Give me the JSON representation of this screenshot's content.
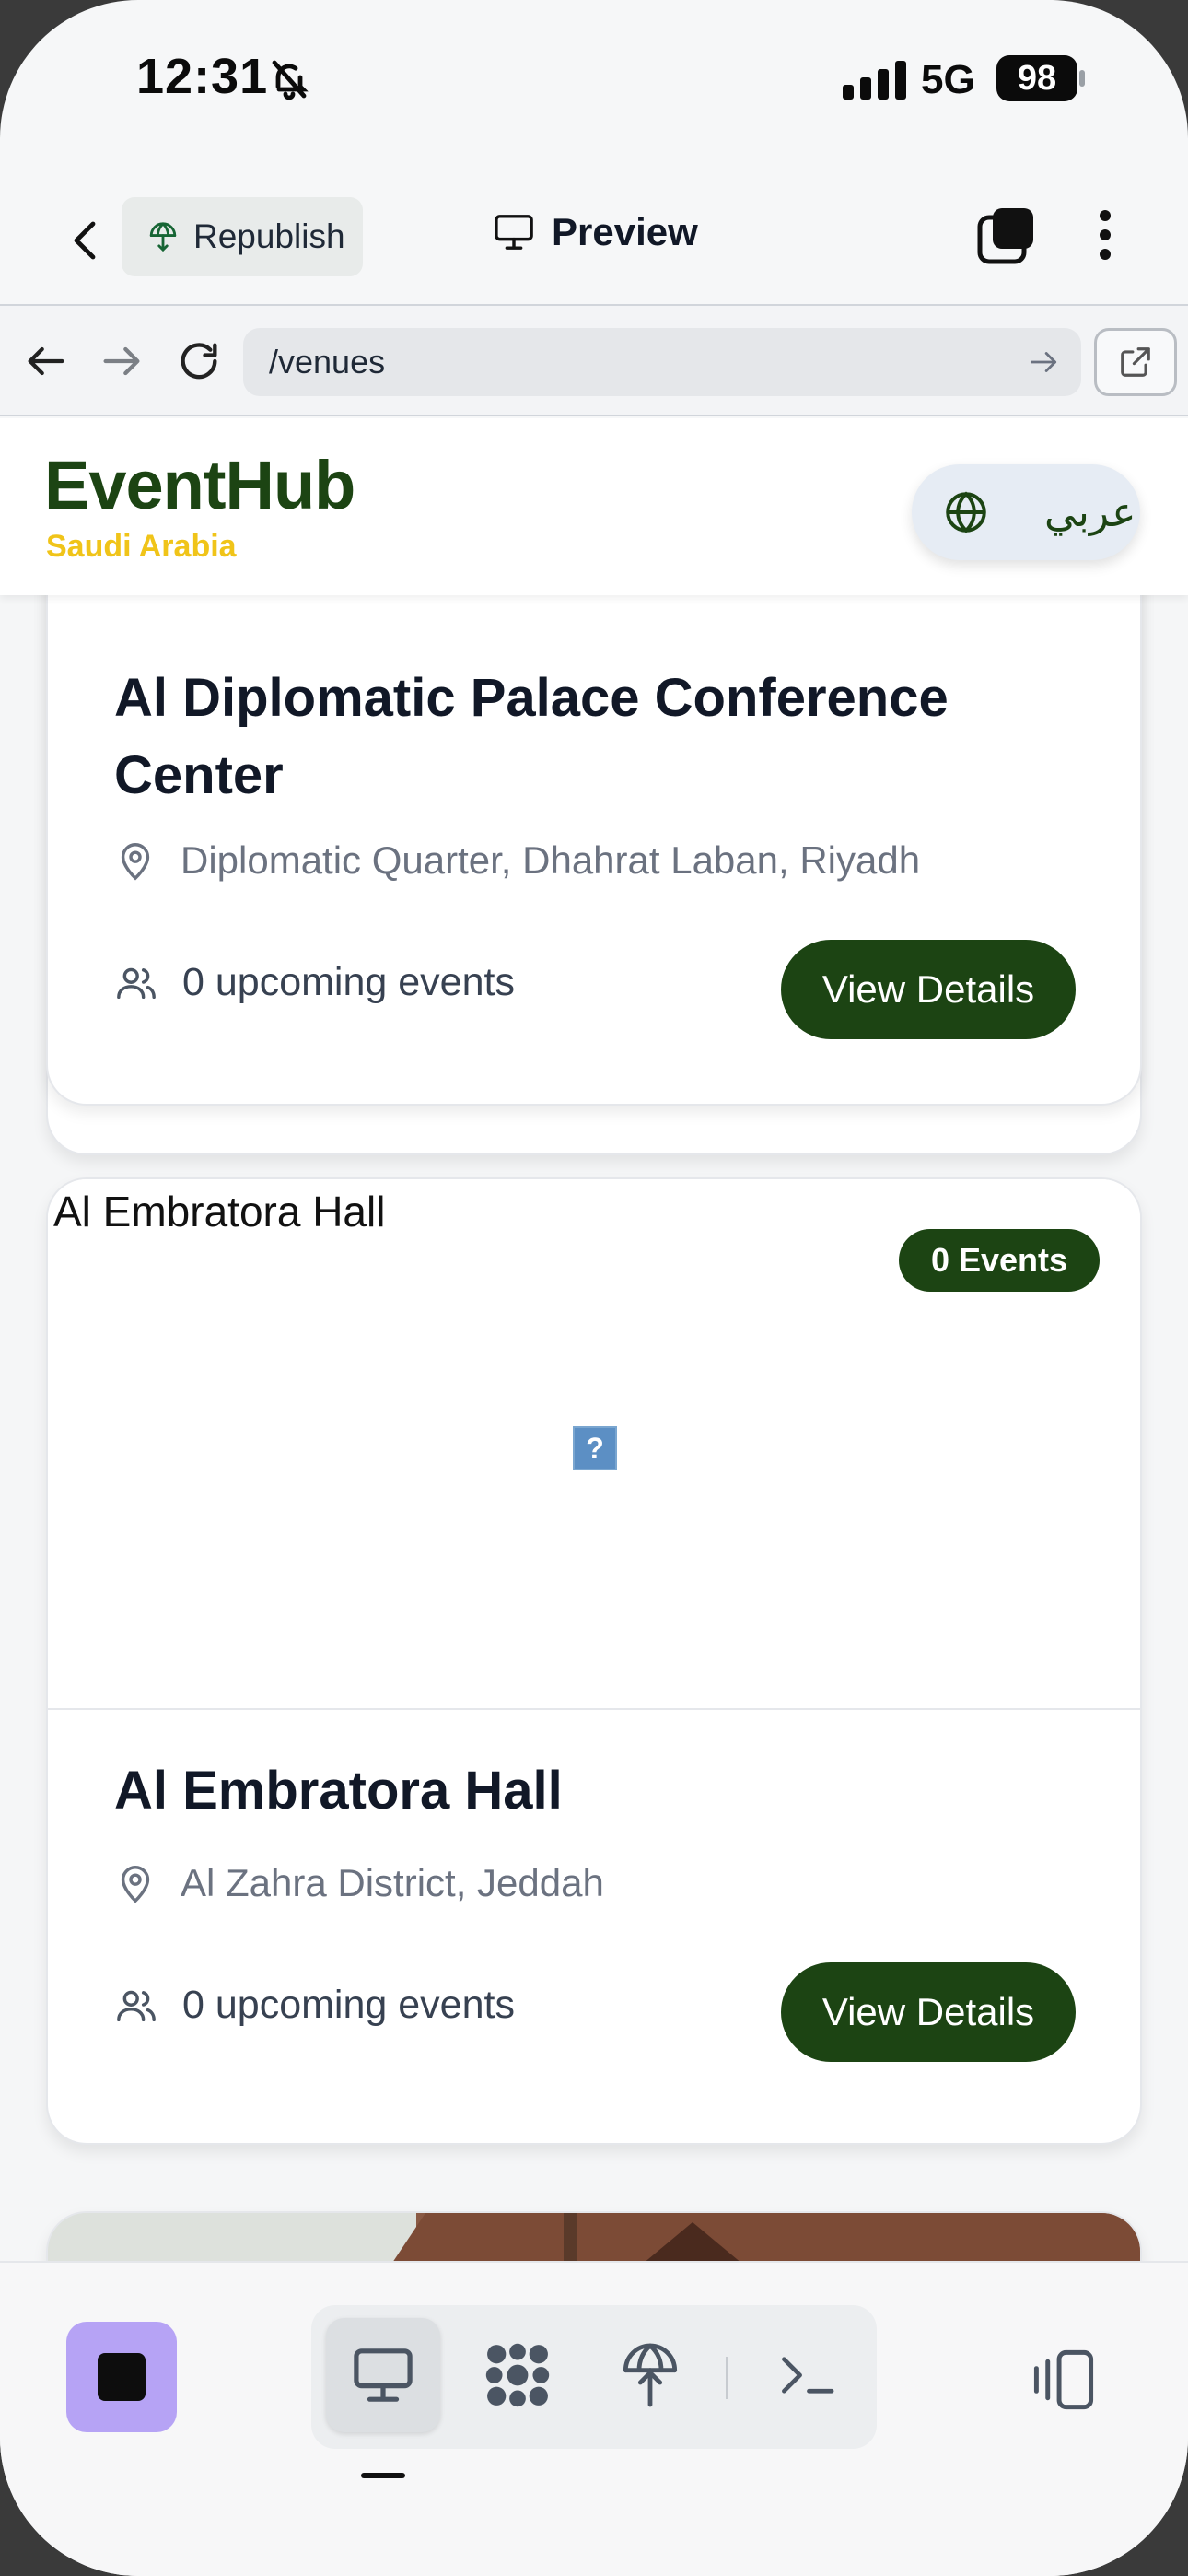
{
  "status": {
    "time": "12:31",
    "network": "5G",
    "battery": "98"
  },
  "toolbar": {
    "republish_label": "Republish",
    "preview_label": "Preview"
  },
  "browser": {
    "url": "/venues"
  },
  "site": {
    "brand": "EventHub",
    "brand_sub": "Saudi Arabia",
    "lang_label": "عربي"
  },
  "venues": [
    {
      "name": "Al Diplomatic Palace Conference Center",
      "location": "Diplomatic Quarter, Dhahrat Laban, Riyadh",
      "events_text": "0 upcoming events",
      "cta": "View Details"
    },
    {
      "image_alt": "Al Embratora Hall",
      "badge": "0 Events",
      "broken_image_glyph": "?",
      "name": "Al Embratora Hall",
      "location": "Al Zahra District, Jeddah",
      "events_text": "0 upcoming events",
      "cta": "View Details"
    }
  ],
  "colors": {
    "brand": "#1c4413",
    "accent": "#f0c419",
    "stop": "#b6a3f5"
  },
  "icons": [
    "bell-slash-icon",
    "signal-icon",
    "back-icon",
    "republish-icon",
    "monitor-icon",
    "tabs-icon",
    "more-icon",
    "arrow-left-icon",
    "arrow-right-icon",
    "reload-icon",
    "external-link-icon",
    "globe-icon",
    "map-pin-icon",
    "users-icon",
    "stop-icon",
    "desktop-icon",
    "apps-icon",
    "deploy-icon",
    "terminal-icon",
    "split-view-icon"
  ]
}
